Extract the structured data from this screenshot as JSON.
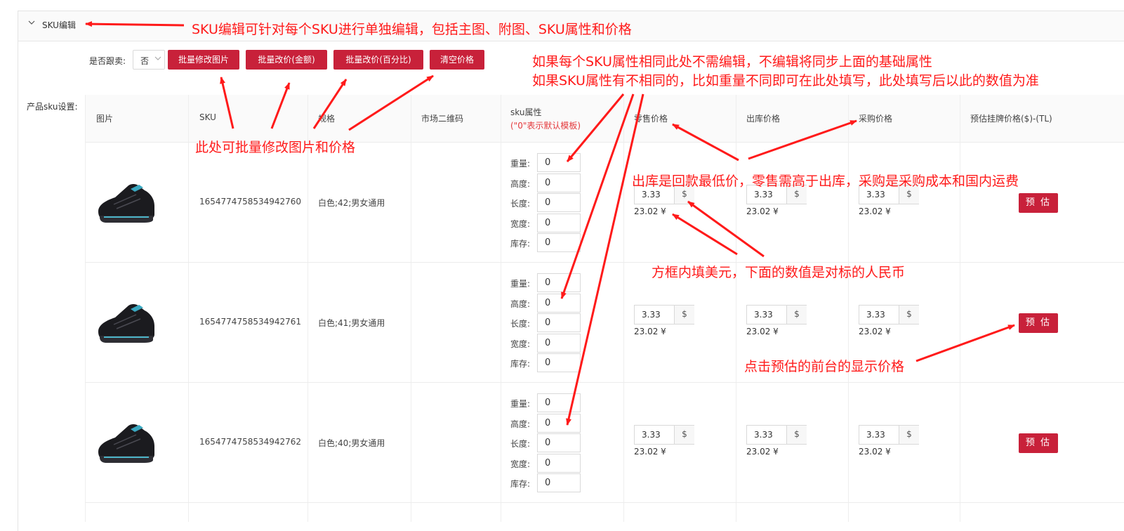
{
  "section": {
    "title": "SKU编辑"
  },
  "toolbar": {
    "follow_label": "是否跟卖:",
    "follow_value": "否",
    "buttons": [
      "批量修改图片",
      "批量改价(金额)",
      "批量改价(百分比)",
      "清空价格"
    ]
  },
  "side_label": "产品sku设置:",
  "columns": {
    "image": "图片",
    "sku": "SKU",
    "spec": "规格",
    "qr": "市场二维码",
    "attr": "sku属性",
    "attr_note": "(\"0\"表示默认模板)",
    "retail": "零售价格",
    "outbound": "出库价格",
    "purchase": "采购价格",
    "estimate": "预估挂牌价格($)-(TL)"
  },
  "attr_labels": [
    "重量:",
    "高度:",
    "长度:",
    "宽度:",
    "库存:"
  ],
  "currency_symbol": "$",
  "estimate_label": "预 估",
  "rows": [
    {
      "sku": "1654774758534942760",
      "spec": "白色;42;男女通用",
      "attrs": [
        "0",
        "0",
        "0",
        "0",
        "0"
      ],
      "retail": "3.33",
      "retail_cny": "23.02 ¥",
      "outbound": "3.33",
      "outbound_cny": "23.02 ¥",
      "purchase": "3.33",
      "purchase_cny": "23.02 ¥"
    },
    {
      "sku": "1654774758534942761",
      "spec": "白色;41;男女通用",
      "attrs": [
        "0",
        "0",
        "0",
        "0",
        "0"
      ],
      "retail": "3.33",
      "retail_cny": "23.02 ¥",
      "outbound": "3.33",
      "outbound_cny": "23.02 ¥",
      "purchase": "3.33",
      "purchase_cny": "23.02 ¥"
    },
    {
      "sku": "1654774758534942762",
      "spec": "白色;40;男女通用",
      "attrs": [
        "0",
        "0",
        "0",
        "0",
        "0"
      ],
      "retail": "3.33",
      "retail_cny": "23.02 ¥",
      "outbound": "3.33",
      "outbound_cny": "23.02 ¥",
      "purchase": "3.33",
      "purchase_cny": "23.02 ¥"
    }
  ],
  "annotations": {
    "a1": "SKU编辑可针对每个SKU进行单独编辑，包括主图、附图、SKU属性和价格",
    "a2": "如果每个SKU属性相同此处不需编辑，不编辑将同步上面的基础属性",
    "a3": "如果SKU属性有不相同的，比如重量不同即可在此处填写，此处填写后以此的数值为准",
    "a4": "此处可批量修改图片和价格",
    "a5": "出库是回款最低价，零售需高于出库，采购是采购成本和国内运费",
    "a6": "方框内填美元，下面的数值是对标的人民币",
    "a7": "点击预估的前台的显示价格"
  },
  "colors": {
    "accent": "#c8213a",
    "annotation": "#ff1a1a"
  }
}
